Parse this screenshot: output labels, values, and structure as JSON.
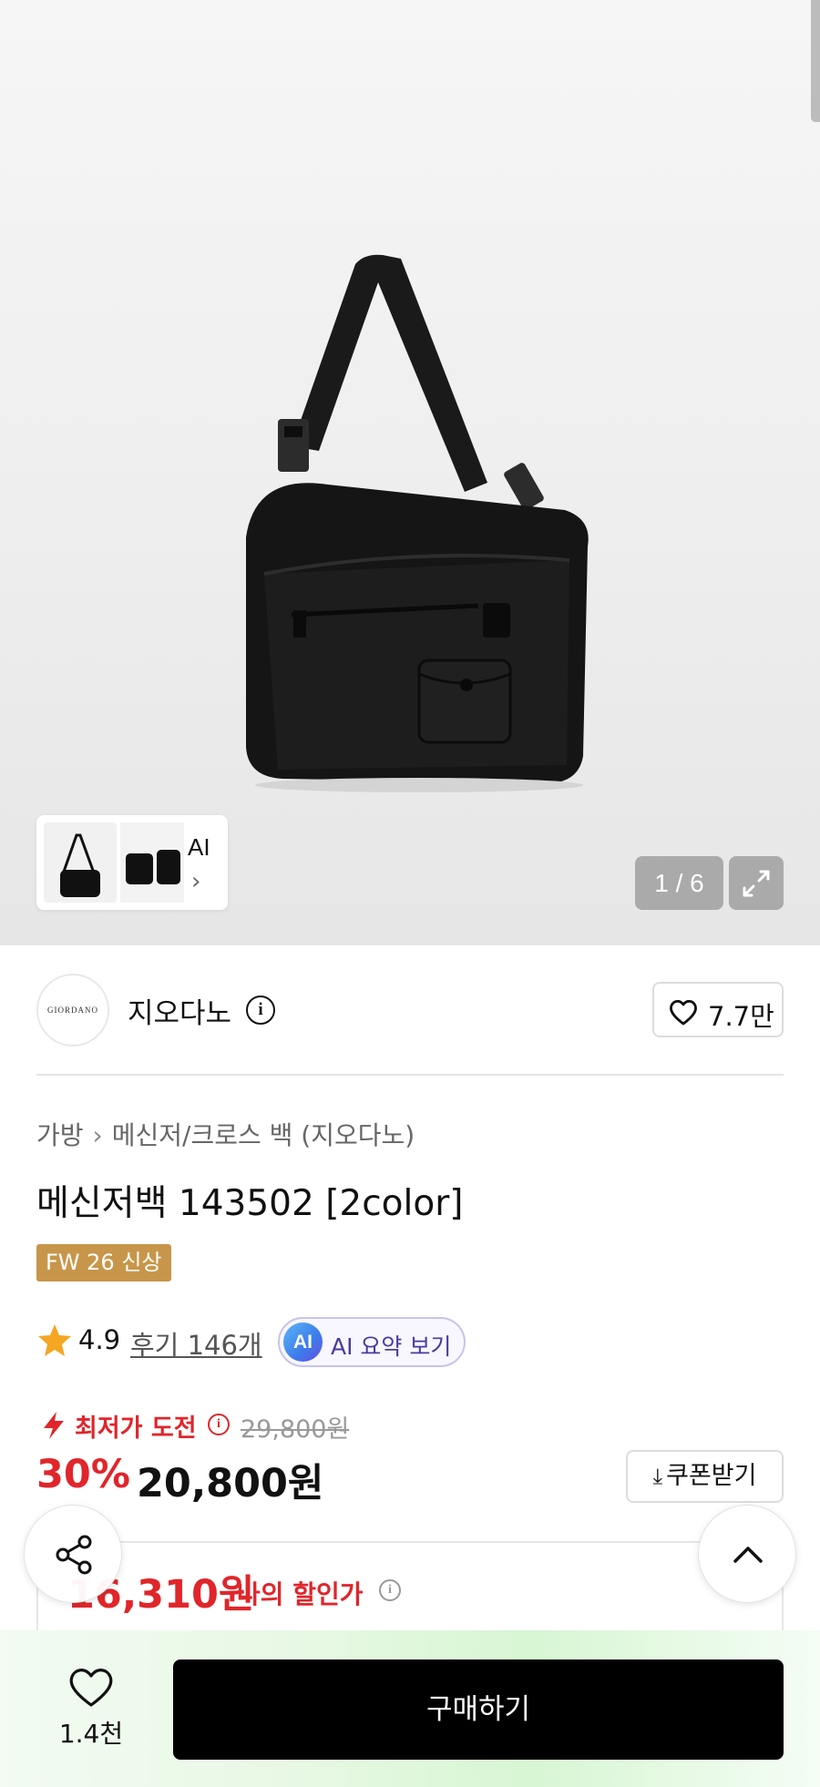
{
  "gallery": {
    "thumb_ai_label": "AI",
    "thumb_chevron": "›",
    "counter": "1 / 6",
    "icons": [
      "expand-icon",
      "chevron-right-icon"
    ]
  },
  "brand": {
    "logo_text": "GIORDANO",
    "name": "지오다노",
    "info_glyph": "i",
    "like_count": "7.7만"
  },
  "breadcrumb": {
    "category": "가방",
    "separator": "›",
    "subcategory": "메신저/크로스 백 (지오다노)"
  },
  "product": {
    "title": "메신저백 143502 [2color]",
    "badge": "FW 26 신상",
    "rating": "4.9",
    "reviews": "후기 146개",
    "ai_badge": "AI",
    "ai_summary": "AI 요약 보기"
  },
  "pricing": {
    "lowest_challenge": "최저가 도전",
    "info_glyph": "i",
    "original_price": "29,800원",
    "discount": "30%",
    "price": "20,800원",
    "coupon_label": "쿠폰받기",
    "coupon_glyph": "⤓",
    "my_price": "16,310원",
    "my_price_label": "나의 할인가"
  },
  "bottom_bar": {
    "wish_count": "1.4천",
    "buy_label": "구매하기"
  },
  "colors": {
    "accent_red": "#e0262b",
    "badge_gold": "#c8964a",
    "ai_purple": "#4a3aa0",
    "buy_black": "#000000"
  }
}
